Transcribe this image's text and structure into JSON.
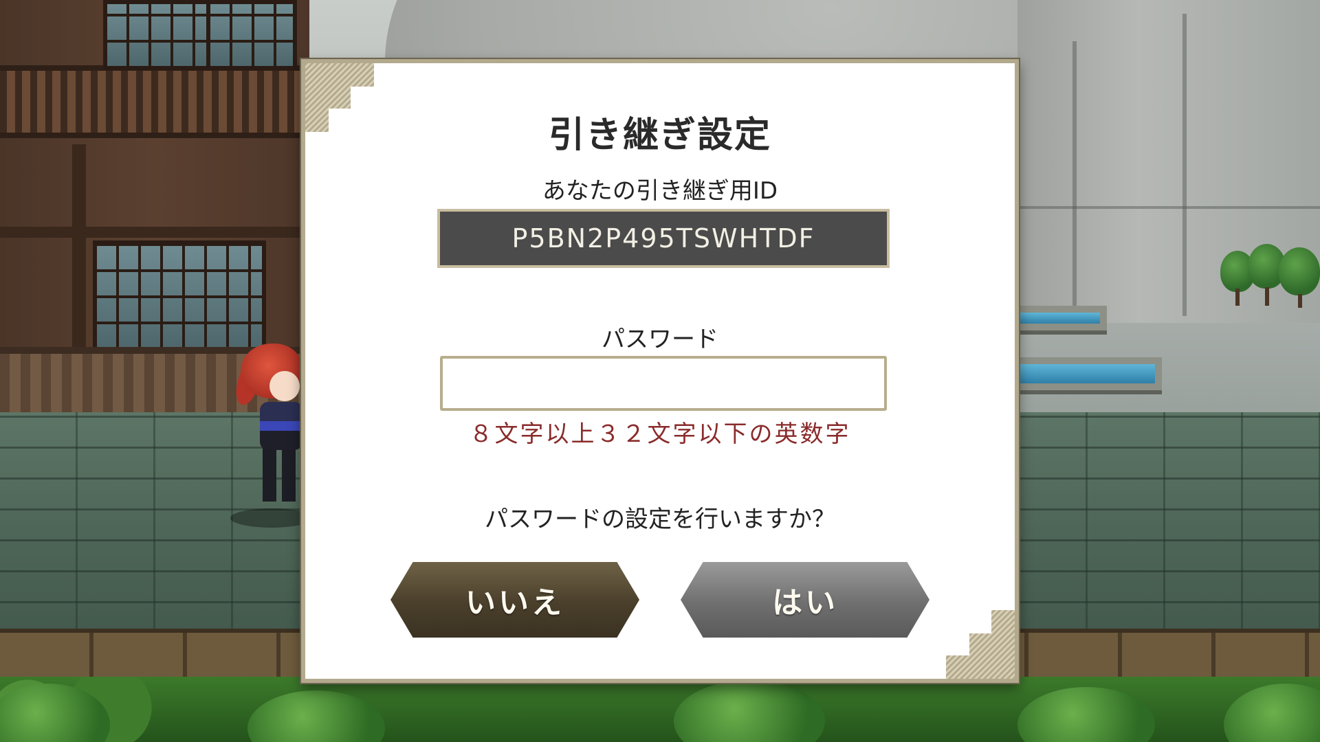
{
  "dialog": {
    "title": "引き継ぎ設定",
    "id_label": "あなたの引き継ぎ用ID",
    "transfer_id": "P5BN2P495TSWHTDF",
    "password_label": "パスワード",
    "password_value": "",
    "password_hint": "８文字以上３２文字以下の英数字",
    "question": "パスワードの設定を行いますか？",
    "buttons": {
      "no_label": "いいえ",
      "yes_label": "はい"
    }
  },
  "colors": {
    "hint_text": "#8a2b2b",
    "id_box_bg": "#4b4b4b",
    "dialog_border": "#b3a98d",
    "no_button": "#4a3f2b",
    "yes_button": "#6f6f6f"
  },
  "icons": {
    "dialog_corner": "checkered-corner-ornament"
  }
}
